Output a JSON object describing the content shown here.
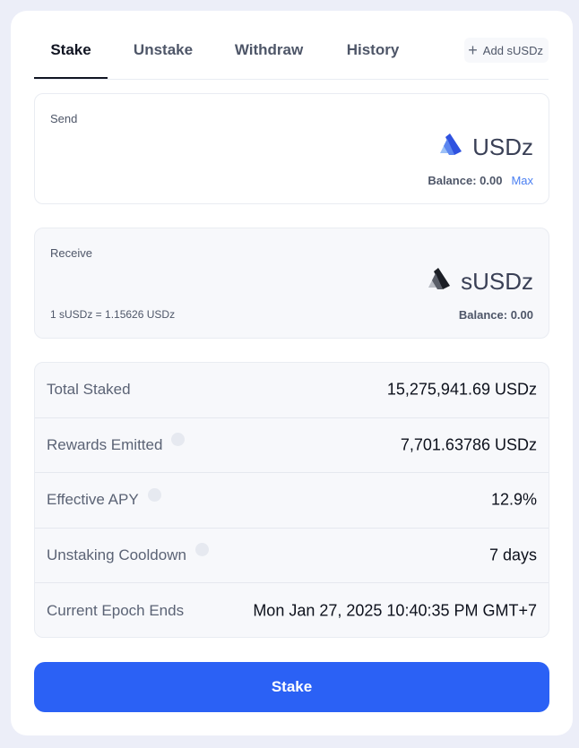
{
  "tabs": [
    {
      "label": "Stake",
      "active": true
    },
    {
      "label": "Unstake",
      "active": false
    },
    {
      "label": "Withdraw",
      "active": false
    },
    {
      "label": "History",
      "active": false
    }
  ],
  "add_token": {
    "label": "Add sUSDz",
    "icon": "plus-icon"
  },
  "send": {
    "label": "Send",
    "token": "USDz",
    "token_icon": "usdz-logo-icon",
    "balance": "Balance: 0.00",
    "max_label": "Max"
  },
  "receive": {
    "label": "Receive",
    "token": "sUSDz",
    "token_icon": "susdz-logo-icon",
    "rate": "1 sUSDz = 1.15626 USDz",
    "balance": "Balance: 0.00"
  },
  "stats": [
    {
      "label": "Total Staked",
      "value": "15,275,941.69 USDz",
      "info": false
    },
    {
      "label": "Rewards Emitted",
      "value": "7,701.63786 USDz",
      "info": true
    },
    {
      "label": "Effective APY",
      "value": "12.9%",
      "info": true
    },
    {
      "label": "Unstaking Cooldown",
      "value": "7 days",
      "info": true
    },
    {
      "label": "Current Epoch Ends",
      "value": "Mon Jan 27, 2025 10:40:35 PM GMT+7",
      "info": false
    }
  ],
  "action": {
    "label": "Stake"
  },
  "colors": {
    "accent": "#2b61f5",
    "link": "#4a7ff2",
    "background": "#eceef8"
  }
}
